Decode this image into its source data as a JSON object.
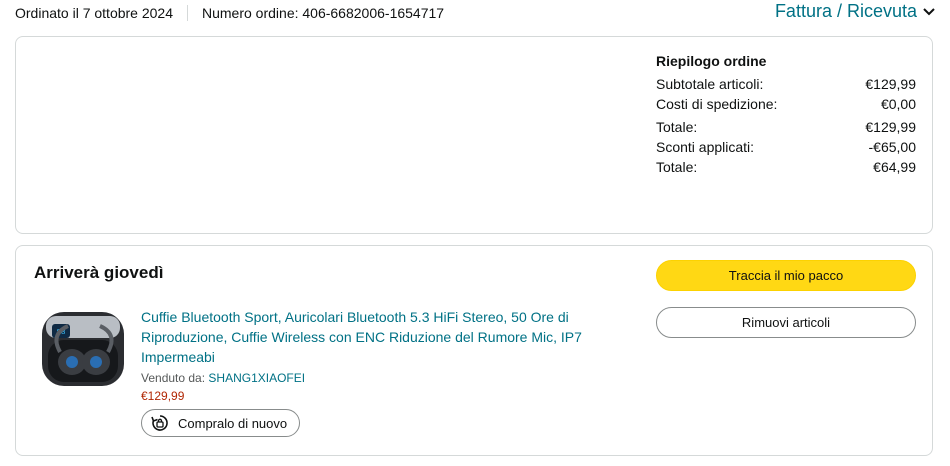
{
  "order_header": {
    "ordered_on": "Ordinato il 7 ottobre 2024",
    "order_number": "Numero ordine: 406-6682006-1654717",
    "invoice_link": "Fattura / Ricevuta"
  },
  "summary": {
    "title": "Riepilogo ordine",
    "rows": [
      {
        "label": "Subtotale articoli:",
        "value": "€129,99"
      },
      {
        "label": "Costi di spedizione:",
        "value": "€0,00"
      },
      {
        "label": "Totale:",
        "value": "€129,99"
      },
      {
        "label": "Sconti applicati:",
        "value": "-€65,00"
      },
      {
        "label": "Totale:",
        "value": "€64,99"
      }
    ]
  },
  "shipment": {
    "title": "Arriverà giovedì",
    "track_button": "Traccia il mio pacco",
    "remove_button": "Rimuovi articoli",
    "product": {
      "title": "Cuffie Bluetooth Sport, Auricolari Bluetooth 5.3 HiFi Stereo, 50 Ore di Riproduzione, Cuffie Wireless con ENC Riduzione del Rumore Mic, IP7 Impermeabi",
      "seller_label": "Venduto da:",
      "seller_name": "SHANG1XIAOFEI",
      "price": "€129,99",
      "buy_again": "Compralo di nuovo"
    }
  },
  "colors": {
    "link": "#007185",
    "track_button": "#ffd814",
    "price": "#b12704"
  }
}
